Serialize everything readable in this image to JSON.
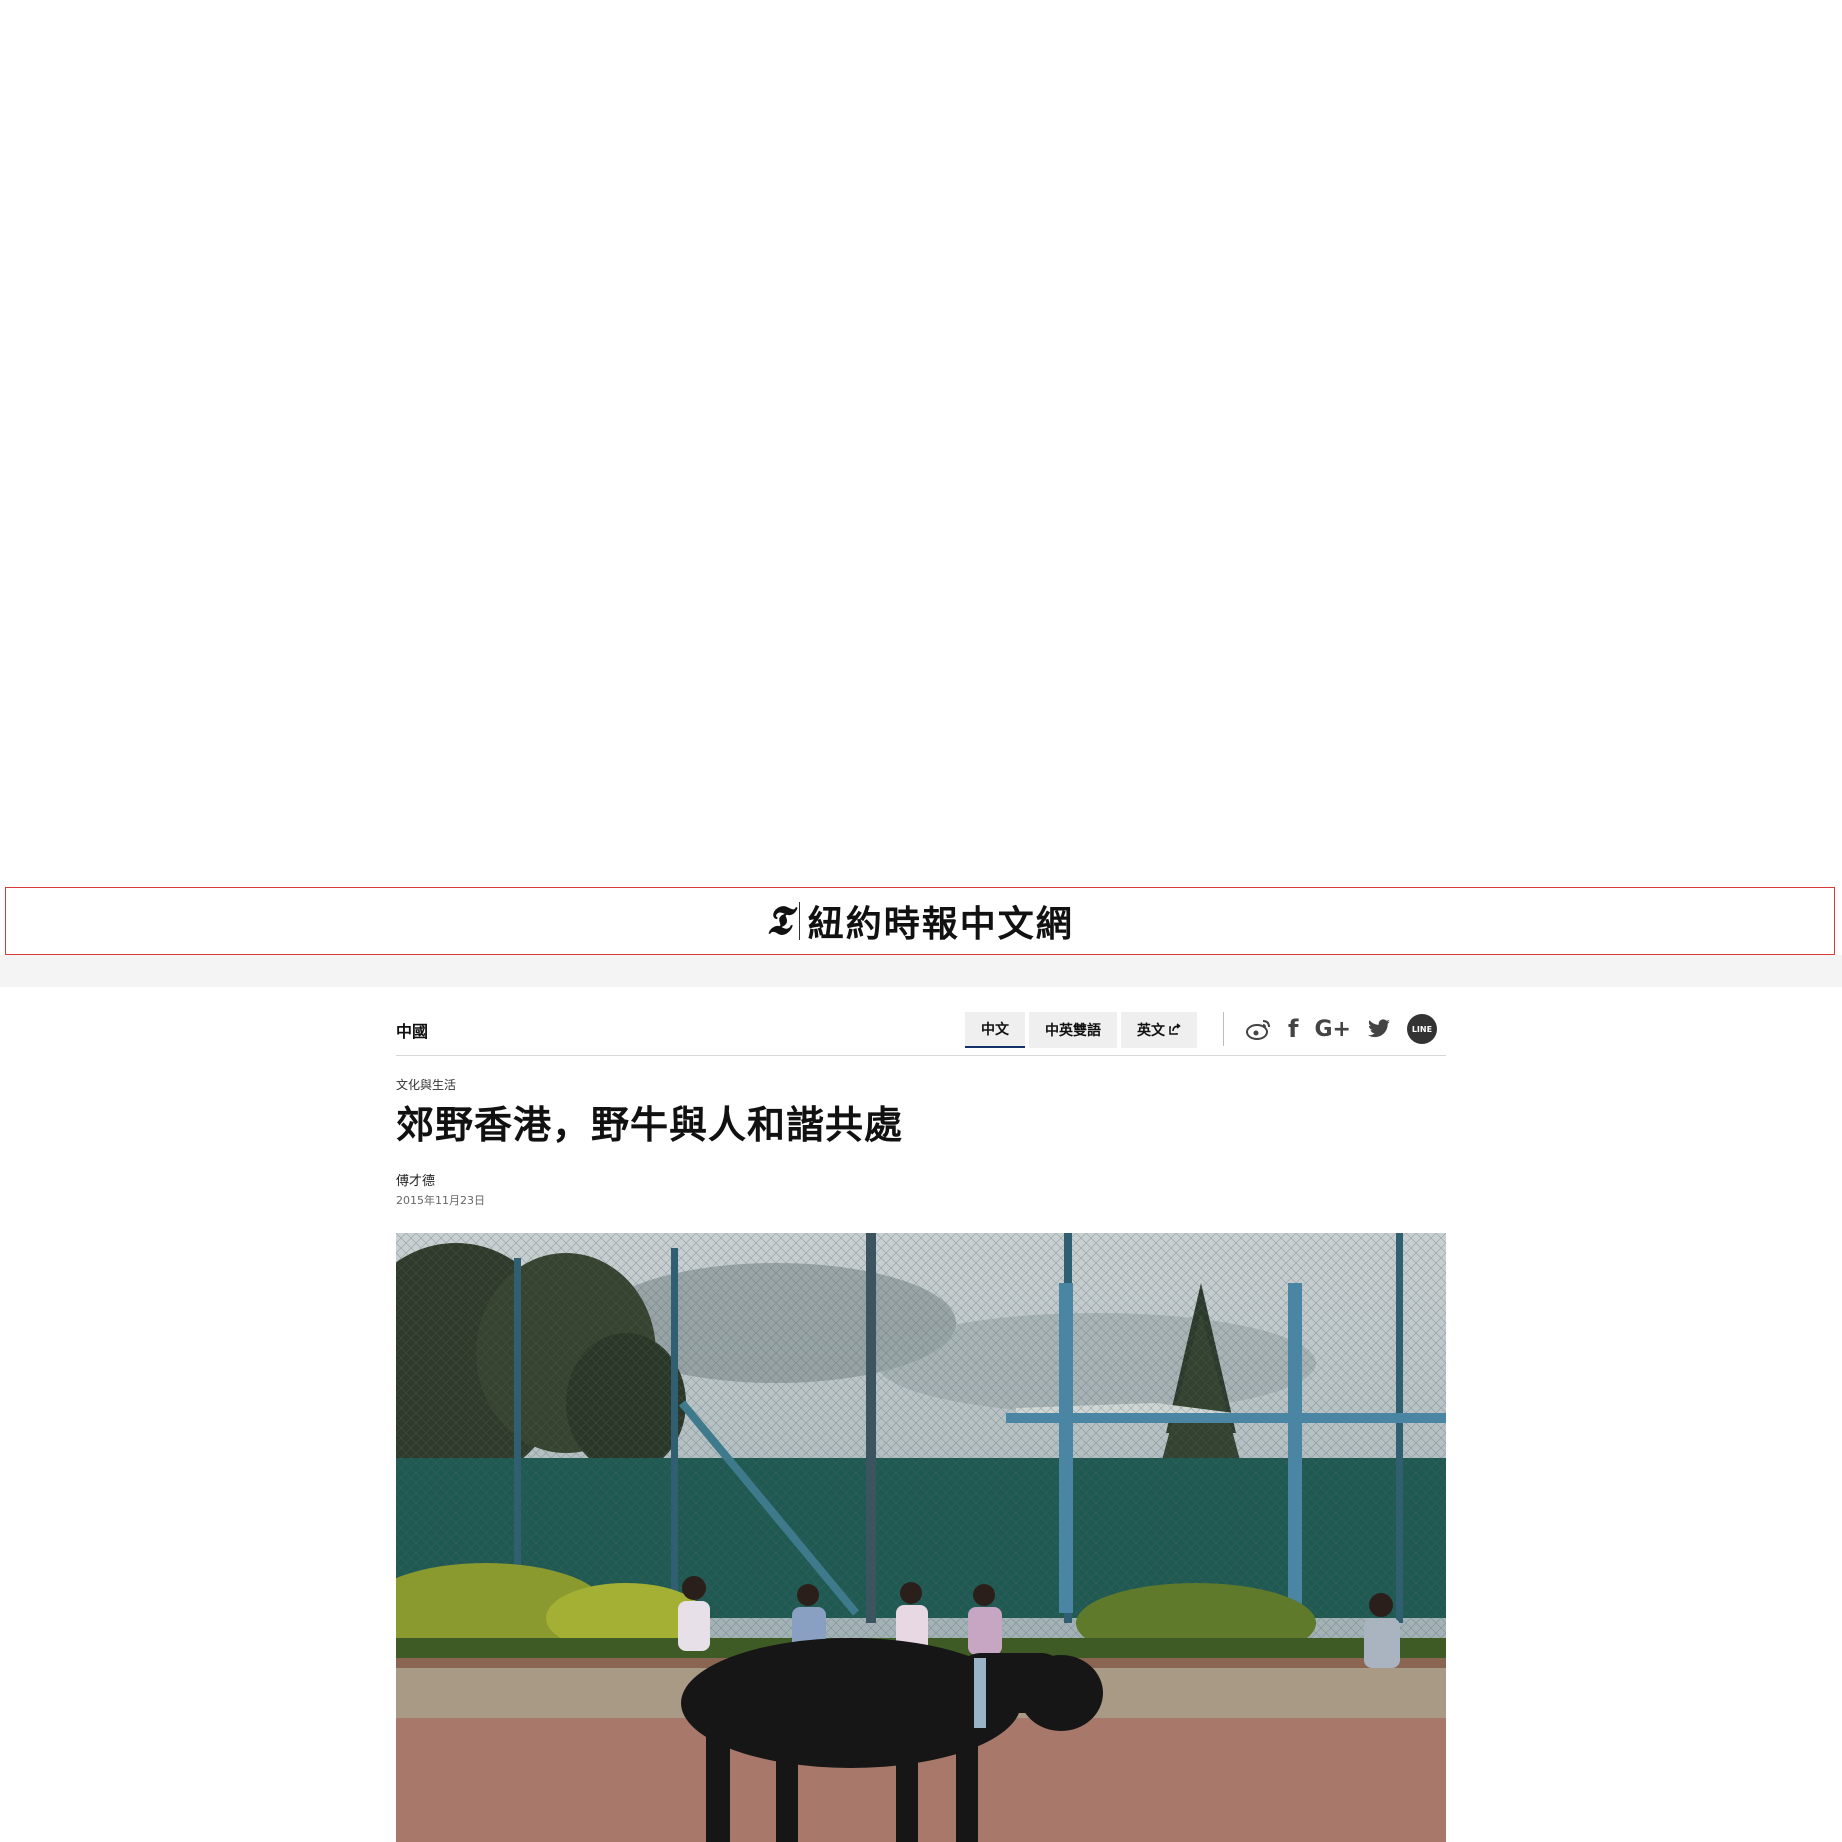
{
  "masthead": {
    "logo_mark": "𝕿",
    "logo_text": "紐約時報中文網"
  },
  "article_header": {
    "section": "中國",
    "language_tabs": [
      {
        "label": "中文",
        "active": true
      },
      {
        "label": "中英雙語",
        "active": false
      },
      {
        "label": "英文",
        "active": false,
        "icon": "external-link-icon"
      }
    ],
    "social_share": [
      {
        "name": "weibo-icon",
        "glyph": "微"
      },
      {
        "name": "facebook-icon",
        "glyph": "f"
      },
      {
        "name": "google-plus-icon",
        "glyph": "G+"
      },
      {
        "name": "twitter-icon",
        "glyph": "🐦"
      },
      {
        "name": "line-icon",
        "glyph": "LINE"
      }
    ]
  },
  "article": {
    "kicker": "文化與生活",
    "headline": "郊野香港，野牛與人和諧共處",
    "byline": "傅才德",
    "date": "2015年11月23日"
  },
  "colors": {
    "masthead_border": "#d83a3a",
    "active_tab_underline": "#14316b",
    "tab_background": "#efefef"
  }
}
